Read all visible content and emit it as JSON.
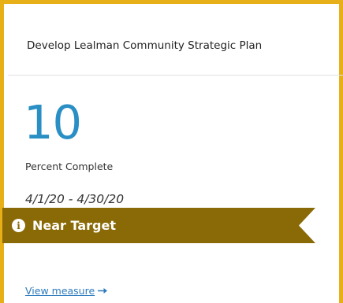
{
  "card": {
    "title": "Develop Lealman Community Strategic Plan",
    "value": "10",
    "value_label": "Percent Complete",
    "date_range": "4/1/20 - 4/30/20",
    "status": {
      "label": "Near Target",
      "icon": "info-icon",
      "color": "#8a6a06"
    },
    "link_label": "View measure",
    "link_icon": "arrow-right-icon",
    "accent_color": "#e7b019",
    "value_color": "#2a8fc4"
  }
}
